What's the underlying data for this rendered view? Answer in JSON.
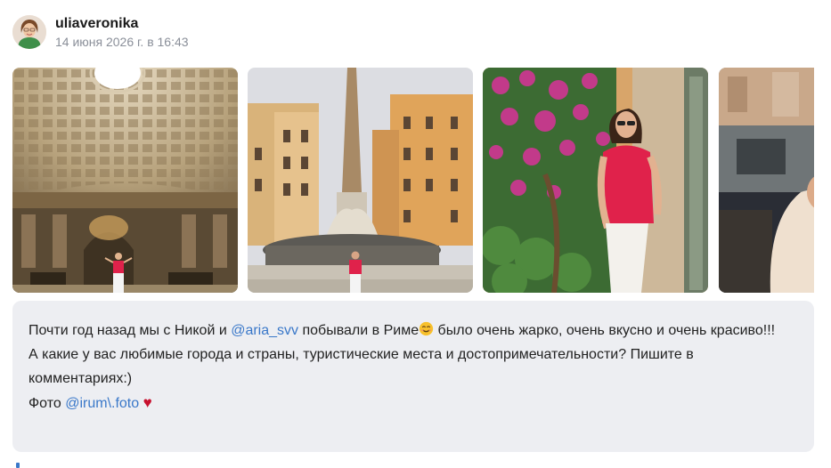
{
  "post": {
    "username": "uliaveronika",
    "date": "14 июня 2026 г. в 16:43"
  },
  "gallery": {
    "photos": [
      {
        "subject": "pantheon-dome-interior"
      },
      {
        "subject": "fountain-obelisk-square"
      },
      {
        "subject": "woman-red-top-flowers-wall"
      },
      {
        "subject": "street-cafe-partial"
      }
    ]
  },
  "caption": {
    "line1_text_a": "Почти год назад мы с Никой и ",
    "mention1": "@aria_svv",
    "line1_text_b": " побывали в Риме",
    "line1_text_c": " было очень жарко, очень вкусно и очень красиво!!!",
    "line2": "А какие у вас любимые города и страны, туристические места и достопримечательности? Пишите в комментариях:)",
    "line3_text": "Фото ",
    "mention2": "@irum\\.foto",
    "heart": "♥"
  },
  "colors": {
    "link": "#3a78c9",
    "caption_bg": "#edeef2",
    "date_gray": "#8a8f99",
    "heart_red": "#c8102e"
  },
  "icons": {
    "emoji": "smiling-face-icon",
    "heart": "heart-icon"
  }
}
